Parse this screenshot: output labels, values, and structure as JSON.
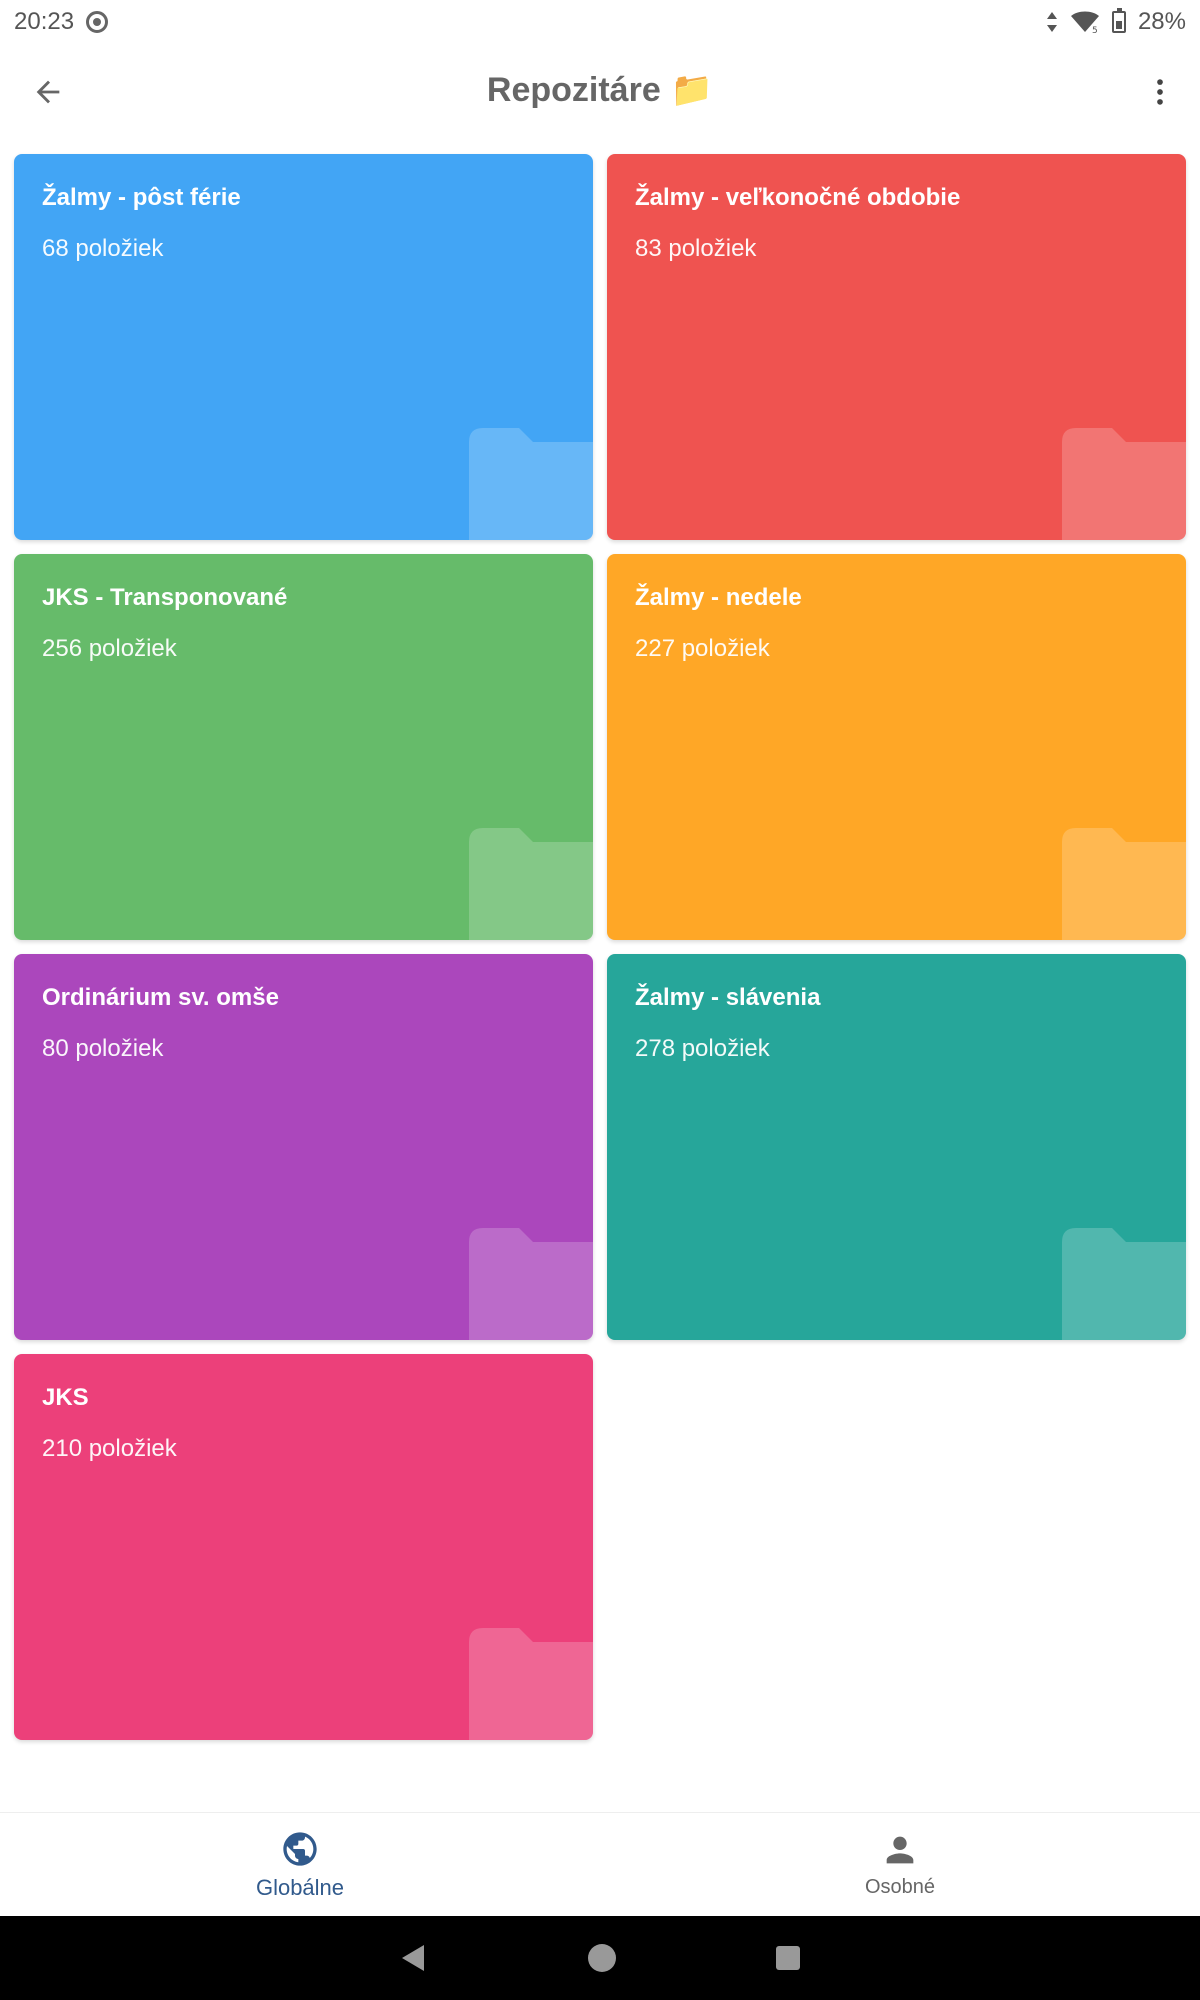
{
  "status_bar": {
    "time": "20:23",
    "battery": "28%"
  },
  "app_bar": {
    "title": "Repozitáre",
    "title_emoji": "📁"
  },
  "cards": [
    {
      "title": "Žalmy - pôst férie",
      "count": "68 položiek",
      "color": "#42a5f5"
    },
    {
      "title": "Žalmy - veľkonočné obdobie",
      "count": "83 položiek",
      "color": "#ef5350"
    },
    {
      "title": "JKS - Transponované",
      "count": "256 položiek",
      "color": "#66bb6a"
    },
    {
      "title": "Žalmy - nedele",
      "count": "227 položiek",
      "color": "#ffa726"
    },
    {
      "title": "Ordinárium sv. omše",
      "count": "80 položiek",
      "color": "#ab47bc"
    },
    {
      "title": "Žalmy - slávenia",
      "count": "278 položiek",
      "color": "#26a69a"
    },
    {
      "title": "JKS",
      "count": "210 položiek",
      "color": "#ec407a"
    }
  ],
  "bottom_nav": {
    "global_label": "Globálne",
    "personal_label": "Osobné",
    "active": "global"
  },
  "icons": {
    "back": "arrow-back-icon",
    "menu": "more-vert-icon",
    "global": "globe-icon",
    "personal": "person-icon",
    "folder": "folder-icon"
  }
}
